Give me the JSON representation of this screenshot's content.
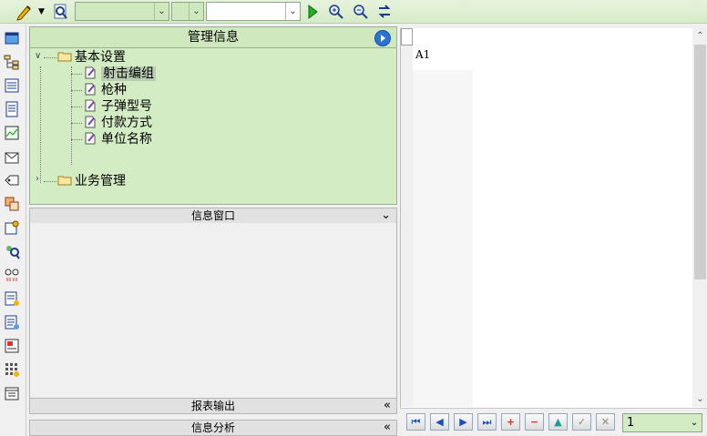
{
  "toolbar": {
    "icons": [
      "pencil-icon",
      "dropdown-arrow",
      "search-doc-icon",
      "run-icon",
      "zoom-in-icon",
      "zoom-out-icon",
      "refresh-icon"
    ],
    "combo1_value": "",
    "combo2_value": "",
    "combo3_value": ""
  },
  "leftbar": {
    "icons": [
      "window-icon",
      "org-tree-icon",
      "list-icon",
      "document-icon",
      "chart-icon",
      "mail-icon",
      "tag-icon",
      "layers-icon",
      "settings-icon",
      "user-search-icon",
      "connection-icon",
      "report-icon",
      "report-settings-icon",
      "form-icon",
      "grid-icon",
      "archive-icon"
    ]
  },
  "management": {
    "title": "管理信息",
    "tree": {
      "root1": "基本设置",
      "children": [
        "射击编组",
        "枪种",
        "子弹型号",
        "付款方式",
        "单位名称"
      ],
      "root2": "业务管理"
    }
  },
  "sections": {
    "info_window": "信息窗口",
    "report_output": "报表输出",
    "info_analysis": "信息分析"
  },
  "sheet": {
    "cell_label": "A1"
  },
  "nav": {
    "page_value": "1"
  },
  "colors": {
    "accent_green": "#d3ecc3",
    "toolbar_green": "#d6ebc6",
    "play_blue": "#2a72d8"
  }
}
